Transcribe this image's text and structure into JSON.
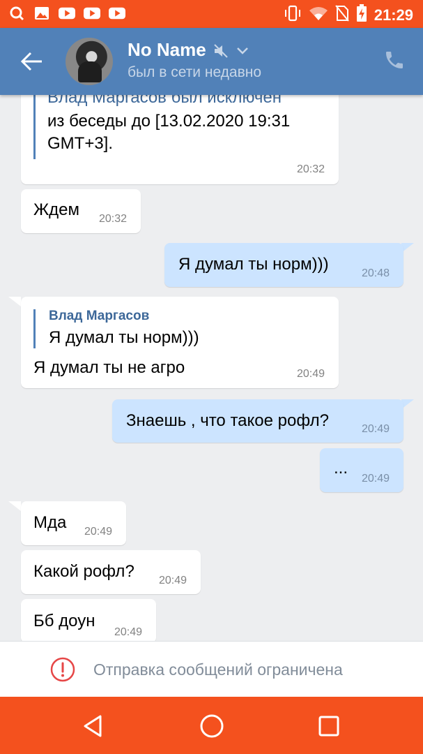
{
  "status_bar": {
    "time": "21:29",
    "left_icons": [
      "q-app-icon",
      "gallery-icon",
      "youtube-icon",
      "youtube-icon",
      "youtube-icon"
    ],
    "right_icons": [
      "vibrate-icon",
      "wifi-icon",
      "no-sim-icon",
      "battery-charging-icon"
    ],
    "background": "#f4511e"
  },
  "header": {
    "name": "No Name",
    "status": "был в сети недавно",
    "background": "#5181b8",
    "icons": [
      "back-arrow-icon",
      "avatar",
      "mute-icon",
      "chevron-down-icon",
      "phone-icon"
    ]
  },
  "messages": [
    {
      "dir": "in",
      "lines": [
        "Влад Маргасов был исключен",
        "из беседы до [13.02.2020 19:31",
        "GMT+3]."
      ],
      "time": "20:32"
    },
    {
      "dir": "in",
      "text": "Ждем",
      "time": "20:32"
    },
    {
      "dir": "out",
      "text": "Я думал ты норм)))",
      "time": "20:48"
    },
    {
      "dir": "in",
      "fwd_name": "Влад Маргасов",
      "fwd_text": "Я думал ты норм)))",
      "text": "Я думал ты не агро",
      "time": "20:49"
    },
    {
      "dir": "out",
      "text": "Знаешь , что такое рофл?",
      "time": "20:49"
    },
    {
      "dir": "out",
      "text": "...",
      "time": "20:49"
    },
    {
      "dir": "in",
      "text": "Мда",
      "time": "20:49"
    },
    {
      "dir": "in",
      "text": "Какой рофл?",
      "time": "20:49"
    },
    {
      "dir": "in",
      "text": "Бб доун",
      "time": "20:49"
    }
  ],
  "restriction": {
    "text": "Отправка сообщений ограничена",
    "icon": "alert-circle-icon",
    "icon_color": "#e64646"
  },
  "navbar": {
    "buttons": [
      "back-triangle-icon",
      "home-circle-icon",
      "recents-square-icon"
    ]
  },
  "colors": {
    "incoming_bubble": "#ffffff",
    "outgoing_bubble": "#cce4ff",
    "feed_background": "#edeef0"
  }
}
